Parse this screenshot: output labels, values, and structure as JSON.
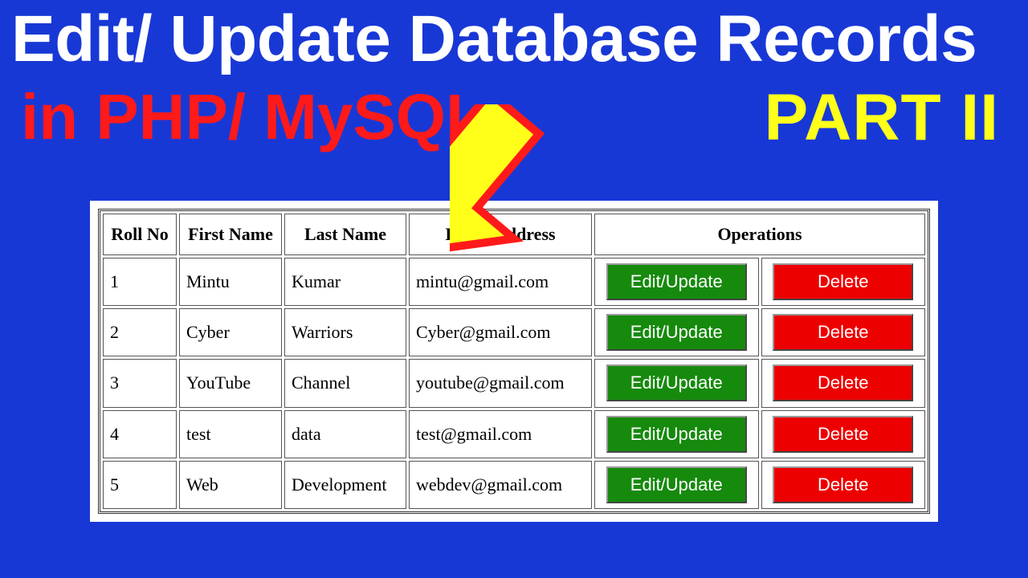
{
  "title": {
    "line1": "Edit/ Update Database Records",
    "line2": "in PHP/ MySQL",
    "part": "PART II"
  },
  "colors": {
    "background": "#1838d6",
    "title1": "#ffffff",
    "title2": "#ff1a1a",
    "part": "#ffff1a",
    "arrow_fill": "#ffff1a",
    "arrow_stroke": "#ff1a1a",
    "btn_edit": "#168a0d",
    "btn_delete": "#ed0000"
  },
  "table": {
    "headers": {
      "roll": "Roll No",
      "first": "First Name",
      "last": "Last Name",
      "email": "Email Address",
      "ops": "Operations"
    },
    "buttons": {
      "edit": "Edit/Update",
      "delete": "Delete"
    },
    "rows": [
      {
        "roll": "1",
        "first": "Mintu",
        "last": "Kumar",
        "email": "mintu@gmail.com"
      },
      {
        "roll": "2",
        "first": "Cyber",
        "last": "Warriors",
        "email": "Cyber@gmail.com"
      },
      {
        "roll": "3",
        "first": "YouTube",
        "last": "Channel",
        "email": "youtube@gmail.com"
      },
      {
        "roll": "4",
        "first": "test",
        "last": "data",
        "email": "test@gmail.com"
      },
      {
        "roll": "5",
        "first": "Web",
        "last": "Development",
        "email": "webdev@gmail.com"
      }
    ]
  }
}
